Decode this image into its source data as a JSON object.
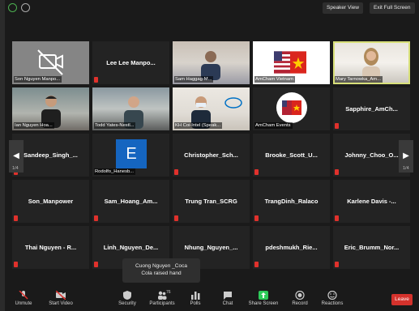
{
  "topbar": {
    "speaker_view": "Speaker View",
    "exit_full_screen": "Exit Full Screen"
  },
  "tiles": [
    {
      "name": "",
      "caption": "Son Nguyen Manpo...",
      "type": "camoff-icon"
    },
    {
      "name": "Lee Lee Manpo...",
      "caption": ""
    },
    {
      "name": "",
      "caption": "Sam Haggag-M...",
      "type": "photo"
    },
    {
      "name": "",
      "caption": "AmCham Vietnam",
      "type": "flag"
    },
    {
      "name": "",
      "caption": "Mary Tarnowka_Am...",
      "type": "photo"
    },
    {
      "name": "",
      "caption": "Ian Nguyen Hoa...",
      "type": "photo"
    },
    {
      "name": "",
      "caption": "Todd Yates-Nestl...",
      "type": "photo"
    },
    {
      "name": "",
      "caption": "KH Coi-Intel (Speak...",
      "type": "photo"
    },
    {
      "name": "",
      "caption": "AmCham Events",
      "type": "flag"
    },
    {
      "name": "Sapphire_AmCh...",
      "caption": ""
    },
    {
      "name": "Sandeep_Singh_...",
      "caption": ""
    },
    {
      "name": "",
      "caption": "Rodolfo_Hanesb...",
      "type": "avatar",
      "avatar_letter": "E"
    },
    {
      "name": "Christopher_Sch...",
      "caption": ""
    },
    {
      "name": "Brooke_Scott_U...",
      "caption": ""
    },
    {
      "name": "Johnny_Choo_O...",
      "caption": ""
    },
    {
      "name": "Son_Manpower",
      "caption": ""
    },
    {
      "name": "Sam_Hoang_Am...",
      "caption": ""
    },
    {
      "name": "Trung Tran_SCRG",
      "caption": ""
    },
    {
      "name": "TrangDinh_Ralaco",
      "caption": ""
    },
    {
      "name": "Karlene Davis -...",
      "caption": ""
    },
    {
      "name": "Thai Nguyen - R...",
      "caption": ""
    },
    {
      "name": "Linh_Nguyen_De...",
      "caption": ""
    },
    {
      "name": "Nhung_Nguyen_...",
      "caption": ""
    },
    {
      "name": "pdeshmukh_Rie...",
      "caption": ""
    },
    {
      "name": "Eric_Brumm_Nor...",
      "caption": ""
    }
  ],
  "pagination": {
    "left": "1/4",
    "right": "1/4"
  },
  "toast": {
    "line1": "Cuong Nguyen _Coca",
    "line2": "Cola raised hand"
  },
  "toolbar": {
    "unmute": "Unmute",
    "start_video": "Start Video",
    "security": "Security",
    "participants": "Participants",
    "participants_count": "76",
    "polls": "Polls",
    "chat": "Chat",
    "share_screen": "Share Screen",
    "record": "Record",
    "reactions": "Reactions",
    "leave": "Leave"
  },
  "colors": {
    "mute_red": "#e0312c",
    "share_green": "#2ecc5a",
    "leave_red": "#d4322c",
    "active_speaker": "#d8e07a"
  }
}
